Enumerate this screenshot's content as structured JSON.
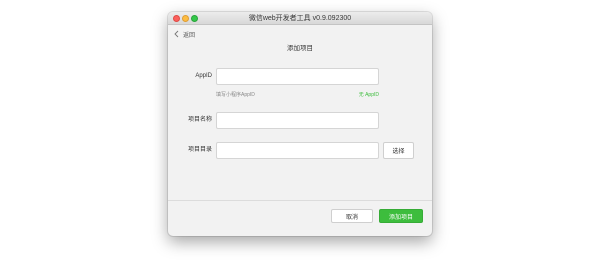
{
  "window": {
    "title": "微信web开发者工具 v0.9.092300"
  },
  "nav": {
    "back_label": "返回",
    "back_icon": "chevron-left-icon"
  },
  "page": {
    "title": "添加项目"
  },
  "form": {
    "appid": {
      "label": "AppID",
      "value": "",
      "placeholder": "",
      "hint": "填写小程序AppID",
      "test_link": "无 AppID"
    },
    "name": {
      "label": "项目名称",
      "value": "",
      "placeholder": ""
    },
    "dir": {
      "label": "项目目录",
      "value": "",
      "placeholder": "",
      "select_label": "选择"
    }
  },
  "footer": {
    "cancel_label": "取消",
    "add_label": "添加项目"
  },
  "colors": {
    "accent": "#3dbd3d",
    "window_bg": "#f2f2f2"
  }
}
